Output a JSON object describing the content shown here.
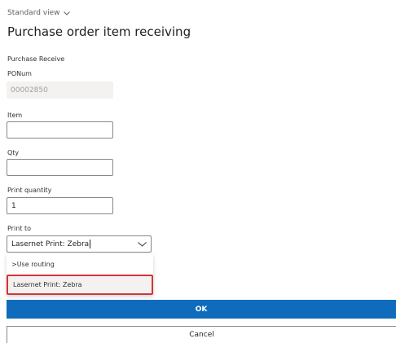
{
  "header": {
    "view_label": "Standard view",
    "title": "Purchase order item receiving"
  },
  "form": {
    "section_label": "Purchase Receive",
    "ponum": {
      "label": "PONum",
      "value": "00002850"
    },
    "item": {
      "label": "Item",
      "value": ""
    },
    "qty": {
      "label": "Qty",
      "value": ""
    },
    "print_quantity": {
      "label": "Print quantity",
      "value": "1"
    },
    "print_to": {
      "label": "Print to",
      "value": "Lasernet Print: Zebra",
      "options": [
        {
          "label": ">Use routing",
          "selected": false
        },
        {
          "label": "Lasernet Print: Zebra",
          "selected": true
        }
      ]
    }
  },
  "actions": {
    "ok_label": "OK",
    "cancel_label": "Cancel"
  },
  "colors": {
    "primary": "#0f6cbd",
    "highlight_border": "#d13438",
    "readonly_bg": "#f3f2f1"
  }
}
